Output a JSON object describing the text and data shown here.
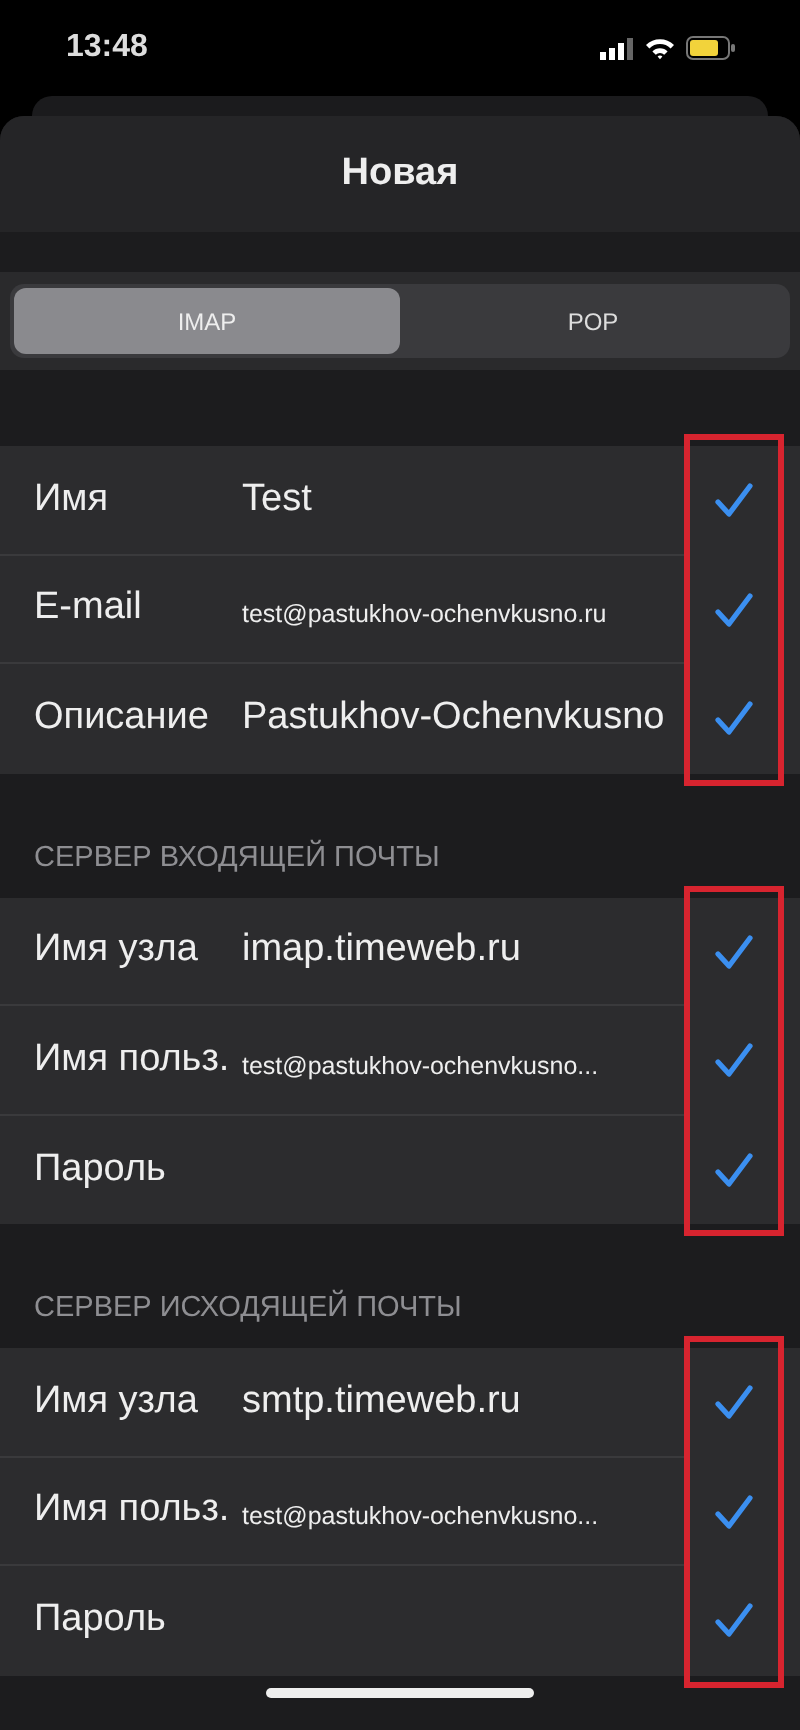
{
  "status_bar": {
    "time": "13:48"
  },
  "sheet": {
    "title": "Новая"
  },
  "segments": [
    {
      "label": "IMAP",
      "selected": true
    },
    {
      "label": "POP",
      "selected": false
    }
  ],
  "groups": [
    {
      "highlighted": true,
      "rows": [
        {
          "label": "Имя",
          "value": "Test",
          "kind": "plain",
          "checked": true
        },
        {
          "label": "E-mail",
          "value": "test@pastukhov-ochenvkusno.ru",
          "kind": "small",
          "checked": true
        },
        {
          "label": "Описание",
          "value": "Pastukhov-Ochenvkusno",
          "kind": "plain",
          "checked": true
        }
      ]
    },
    {
      "header": "СЕРВЕР ВХОДЯЩЕЙ ПОЧТЫ",
      "highlighted": true,
      "rows": [
        {
          "label": "Имя узла",
          "value": "imap.timeweb.ru",
          "kind": "plain",
          "checked": true
        },
        {
          "label": "Имя польз.",
          "value": "test@pastukhov-ochenvkusno...",
          "kind": "small",
          "checked": true
        },
        {
          "label": "Пароль",
          "checked": true
        }
      ]
    },
    {
      "header": "СЕРВЕР ИСХОДЯЩЕЙ ПОЧТЫ",
      "highlighted": true,
      "rows": [
        {
          "label": "Имя узла",
          "value": "smtp.timeweb.ru",
          "kind": "plain",
          "checked": true
        },
        {
          "label": "Имя польз.",
          "value": "test@pastukhov-ochenvkusno...",
          "kind": "small",
          "checked": true
        },
        {
          "label": "Пароль",
          "checked": true
        }
      ]
    }
  ]
}
